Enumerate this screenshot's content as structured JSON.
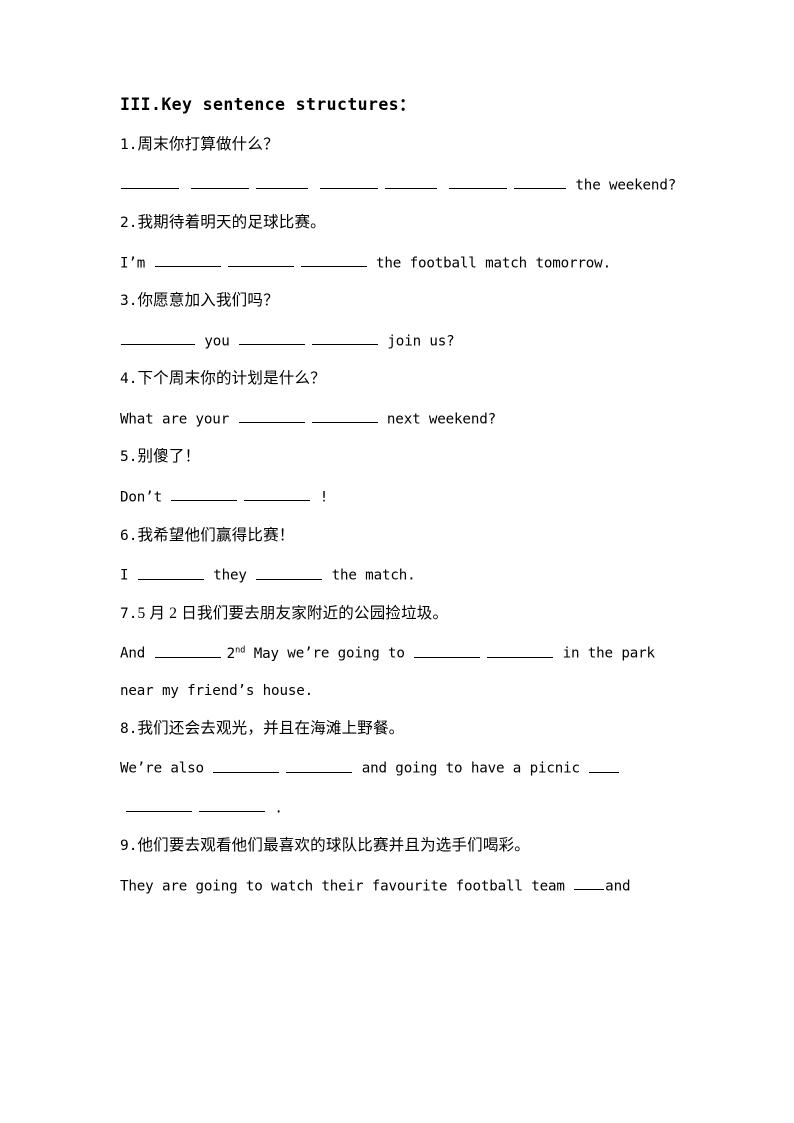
{
  "document": {
    "heading": "III.Key sentence structures：",
    "items": [
      {
        "number": "1.",
        "chinese": "周末你打算做什么？",
        "english_parts": {
          "blanks_before": 7,
          "tail": "the weekend?"
        }
      },
      {
        "number": "2.",
        "chinese": "我期待着明天的足球比赛。",
        "english_parts": {
          "lead": "I’m",
          "blanks": 3,
          "tail": "the football match tomorrow."
        }
      },
      {
        "number": "3.",
        "chinese": "你愿意加入我们吗？",
        "english_parts": {
          "lead": "",
          "mid": "you",
          "tail": "join us?"
        }
      },
      {
        "number": "4.",
        "chinese": "下个周末你的计划是什么？",
        "english_parts": {
          "lead": "What are your",
          "blanks": 2,
          "tail": "next weekend?"
        }
      },
      {
        "number": "5.",
        "chinese": "别傻了！",
        "english_parts": {
          "lead": "Don’t",
          "blanks": 2,
          "tail": "!"
        }
      },
      {
        "number": "6.",
        "chinese": "我希望他们赢得比赛！",
        "english_parts": {
          "lead": "I",
          "mid": "they",
          "tail": "the match."
        }
      },
      {
        "number": "7.",
        "chinese": "5 月 2 日我们要去朋友家附近的公园捡垃圾。",
        "english_parts": {
          "lead": "And",
          "date_number": "2",
          "date_suffix": "nd",
          "date_month": "May",
          "mid": "we’re going to",
          "tail": "in the park",
          "line2": "near my friend’s house."
        }
      },
      {
        "number": "8.",
        "chinese": "我们还会去观光，并且在海滩上野餐。",
        "english_parts": {
          "lead": "We’re also",
          "mid": "and going to have a picnic",
          "line2_end": "."
        }
      },
      {
        "number": "9.",
        "chinese": "他们要去观看他们最喜欢的球队比赛并且为选手们喝彩。",
        "english_parts": {
          "lead": "They are going to watch their favourite football team",
          "tail": "and"
        }
      }
    ]
  }
}
